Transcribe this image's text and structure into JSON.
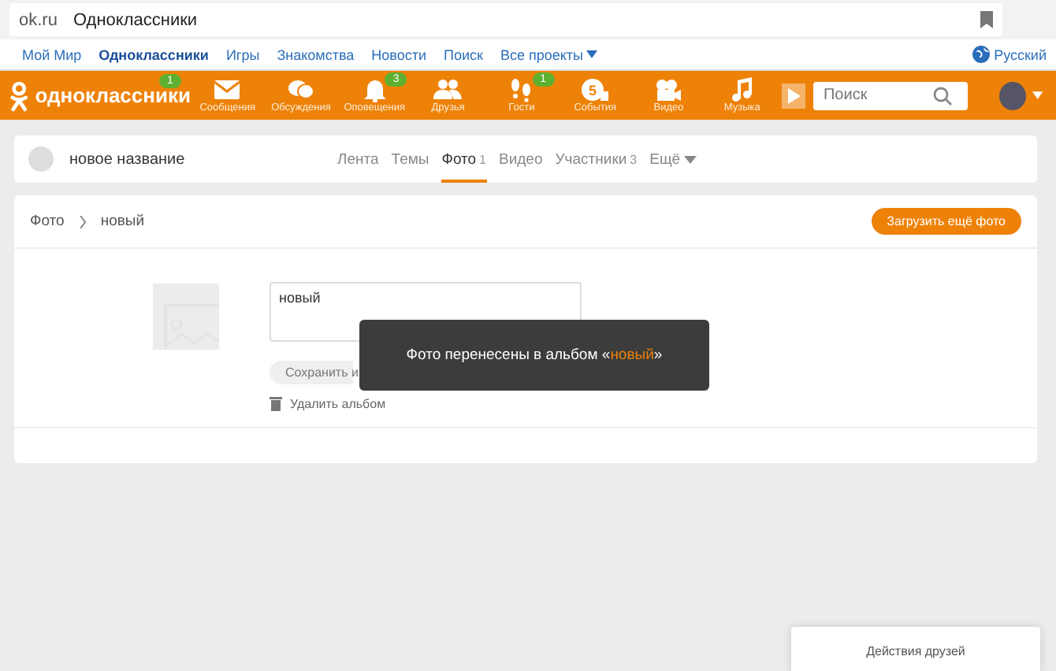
{
  "browser": {
    "url": "ok.ru",
    "title": "Одноклассники"
  },
  "portal_links": [
    {
      "label": "Мой Мир",
      "selected": false
    },
    {
      "label": "Одноклассники",
      "selected": true
    },
    {
      "label": "Игры",
      "selected": false
    },
    {
      "label": "Знакомства",
      "selected": false
    },
    {
      "label": "Новости",
      "selected": false
    },
    {
      "label": "Поиск",
      "selected": false
    }
  ],
  "all_projects": "Все проекты",
  "language": "Русский",
  "nav": {
    "logo": "одноклассники",
    "logo_badge": "1",
    "search_placeholder": "Поиск",
    "items": [
      {
        "kind": "messages",
        "label": "Сообщения"
      },
      {
        "kind": "discussions",
        "label": "Обсуждения"
      },
      {
        "kind": "notifications",
        "label": "Оповещения",
        "badge": "3"
      },
      {
        "kind": "friends",
        "label": "Друзья"
      },
      {
        "kind": "guests",
        "label": "Гости",
        "badge": "1"
      },
      {
        "kind": "events",
        "label": "События",
        "icon_text": "5"
      },
      {
        "kind": "video",
        "label": "Видео"
      },
      {
        "kind": "music",
        "label": "Музыка"
      }
    ]
  },
  "group": {
    "name": "новое название",
    "more": "Ещё",
    "tabs": [
      {
        "label": "Лента",
        "selected": false
      },
      {
        "label": "Темы",
        "selected": false
      },
      {
        "label": "Фото",
        "count": "1",
        "selected": true
      },
      {
        "label": "Видео",
        "selected": false
      },
      {
        "label": "Участники",
        "count": "3",
        "selected": false
      }
    ]
  },
  "album": {
    "breadcrumb": [
      "Фото",
      "новый"
    ],
    "upload_button": "Загрузить ещё фото",
    "name_value": "новый",
    "save_button": "Сохранить и",
    "delete_link": "Удалить альбом"
  },
  "toast": {
    "text": "Фото перенесены в альбом «",
    "link": "новый",
    "suffix": "»"
  },
  "friends_panel": "Действия друзей"
}
